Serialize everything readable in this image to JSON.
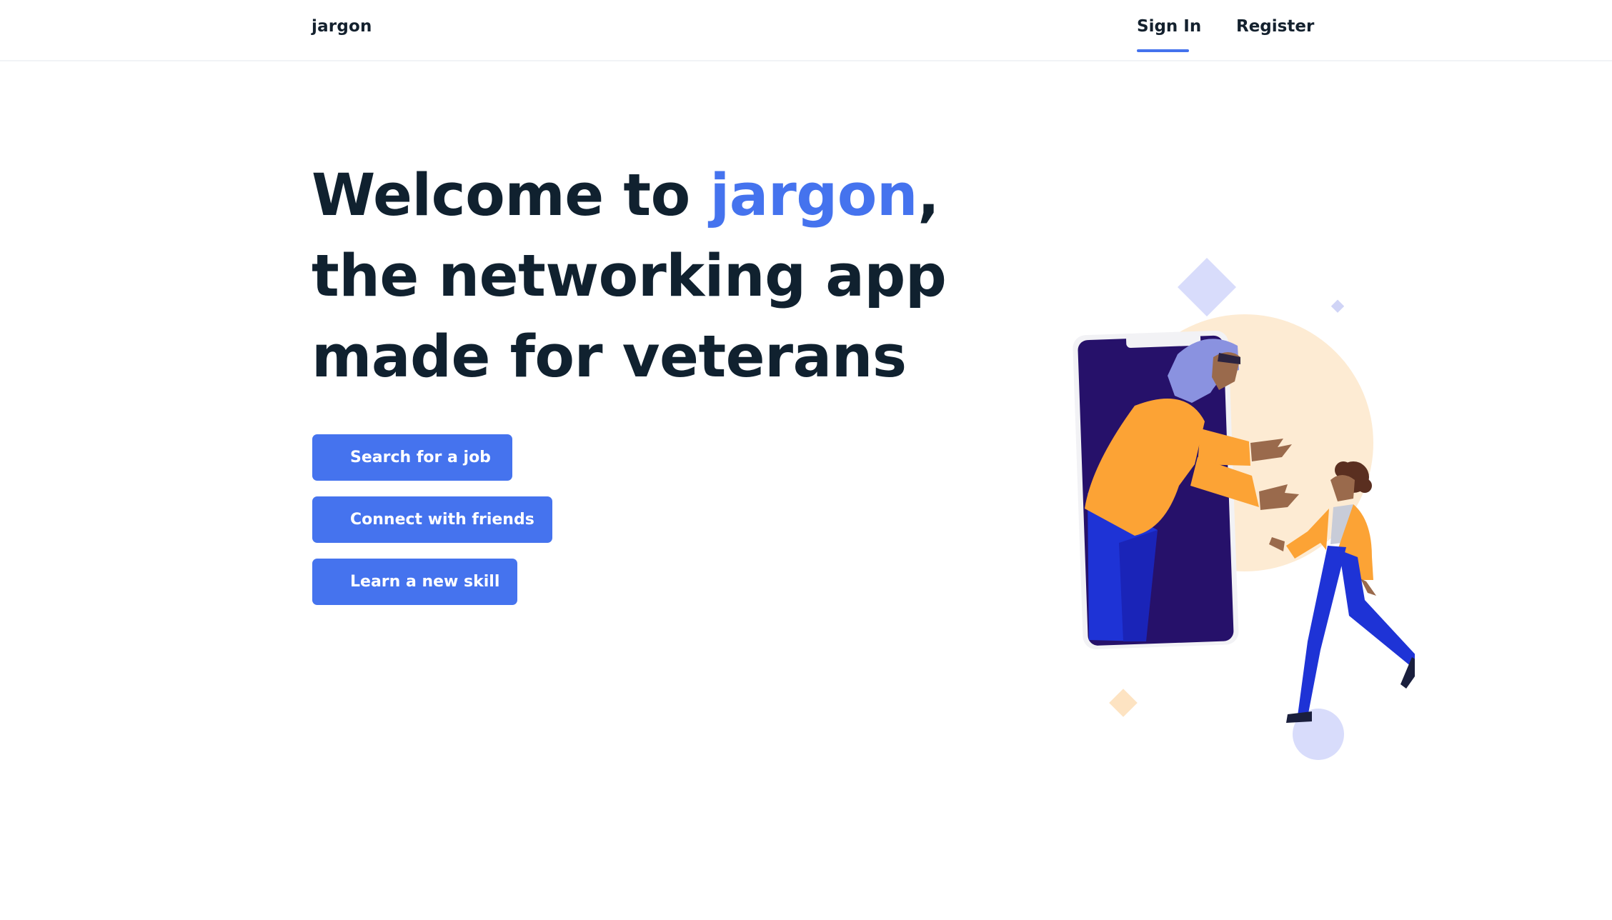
{
  "header": {
    "brand": "jargon",
    "nav": {
      "sign_in": "Sign In",
      "register": "Register",
      "active": "sign_in"
    }
  },
  "hero": {
    "title_prefix": "Welcome to ",
    "title_accent": "jargon",
    "title_comma": ",",
    "title_line2": "the networking app",
    "title_line3": "made for veterans",
    "buttons": {
      "search_job": "Search for a job",
      "connect_friends": "Connect with friends",
      "learn_skill": "Learn a new skill"
    }
  },
  "colors": {
    "accent": "#4573ee",
    "heading": "#10212f",
    "illustration_phone": "#26116a",
    "illustration_orange": "#fca335",
    "illustration_blue": "#1e33d6",
    "illustration_lavender": "#8a92e0",
    "illustration_cream": "#fdebd3"
  },
  "illustration": {
    "icon": "welcome-illustration"
  }
}
